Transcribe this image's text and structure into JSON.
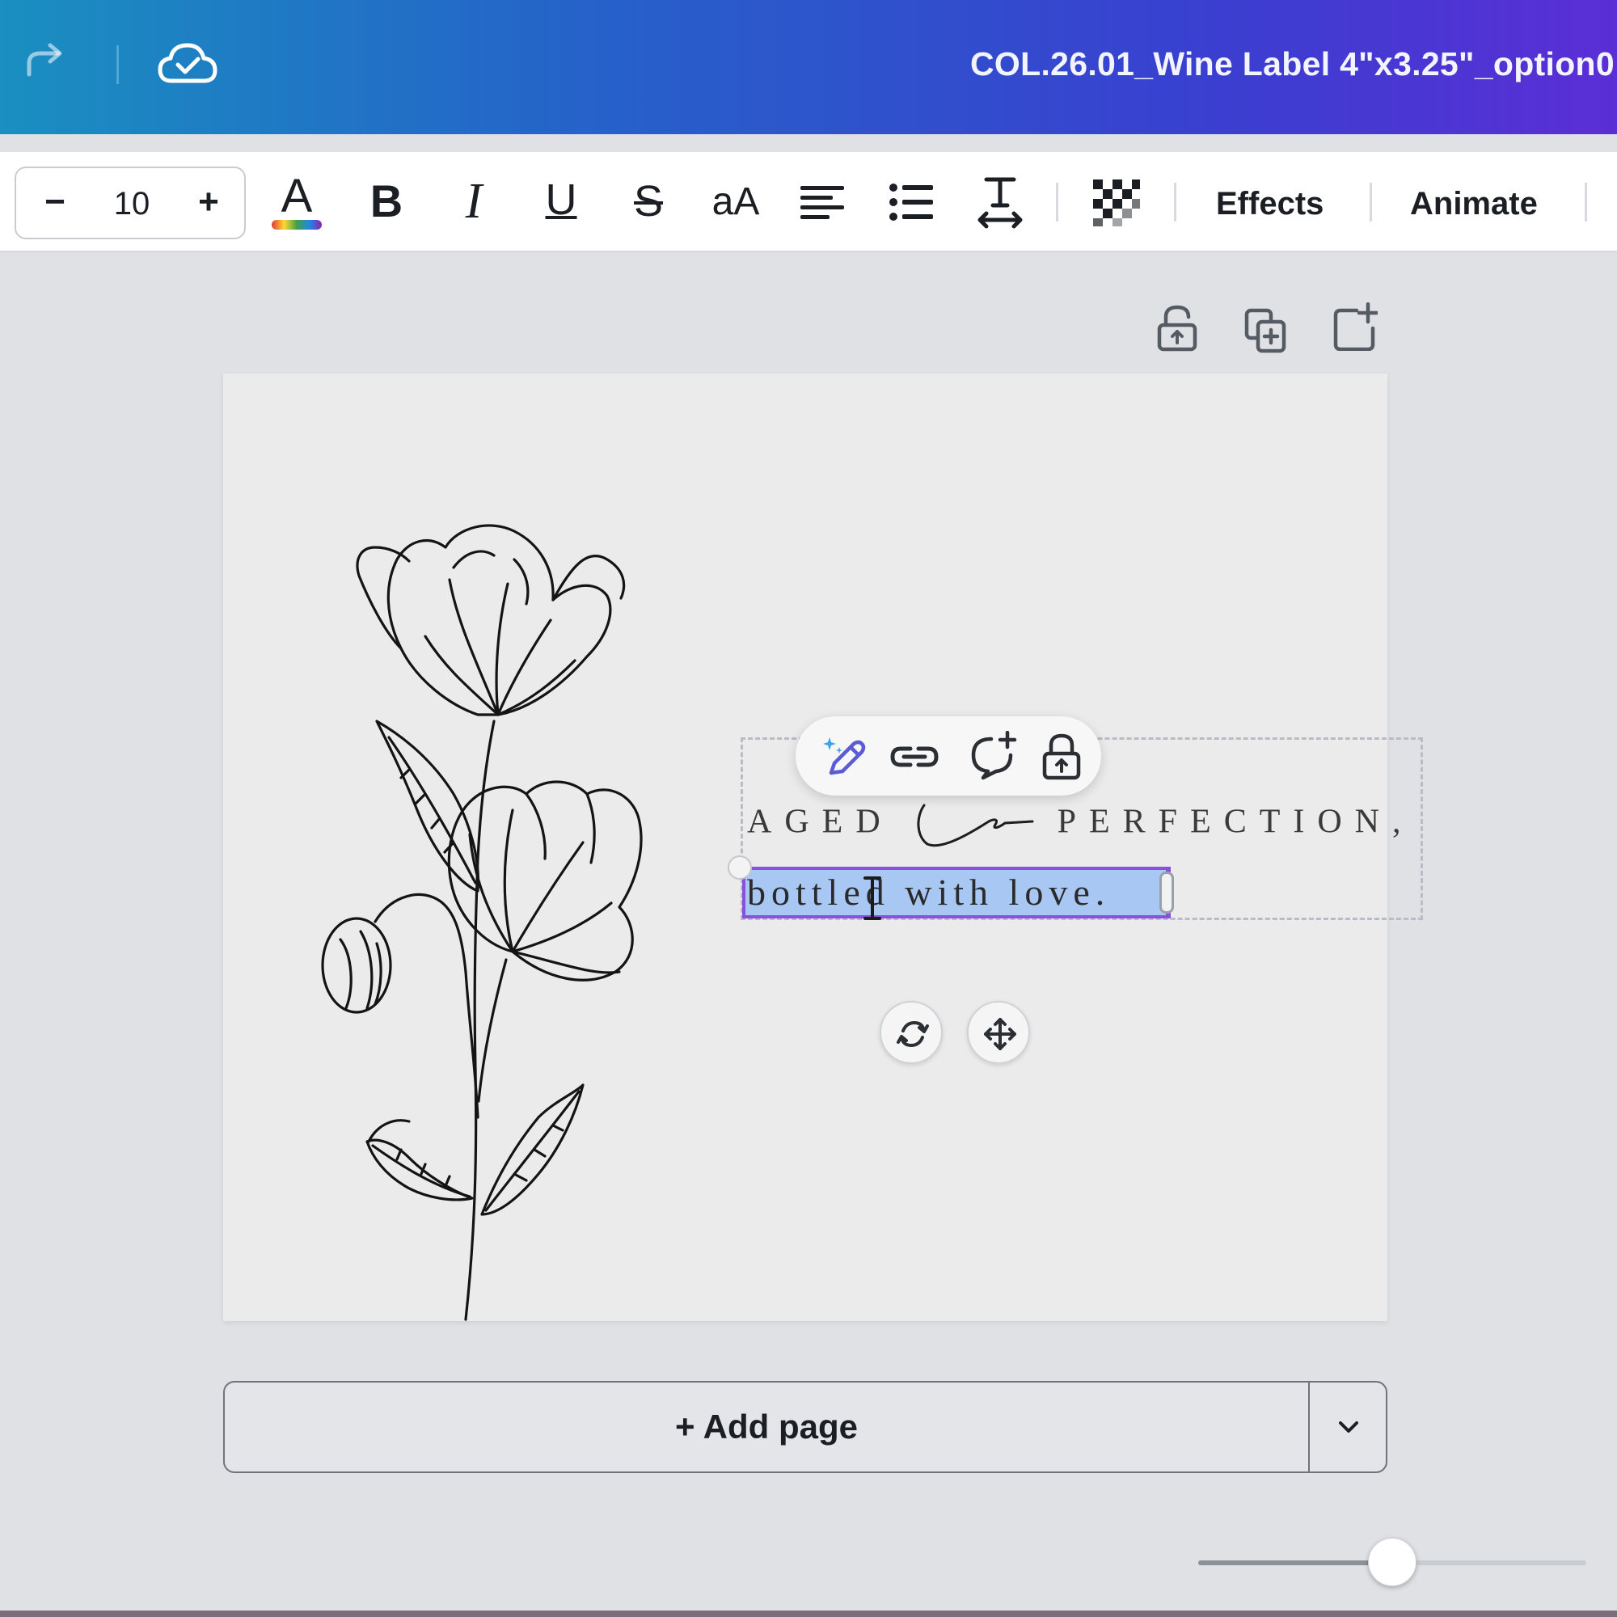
{
  "header": {
    "title": "COL.26.01_Wine Label 4\"x3.25\"_option0",
    "icons": [
      "redo-icon",
      "cloud-saved-icon"
    ]
  },
  "toolbar": {
    "font_size": "10",
    "decrease_label": "−",
    "increase_label": "+",
    "text_color_letter": "A",
    "bold_label": "B",
    "italic_label": "I",
    "underline_label": "U",
    "strikethrough_label": "S",
    "case_label": "aA",
    "effects_label": "Effects",
    "animate_label": "Animate"
  },
  "page_actions": [
    "lock-page-icon",
    "duplicate-page-icon",
    "add-page-icon"
  ],
  "design": {
    "line1_left": "AGED",
    "line1_right": "PERFECTION,",
    "selected_text": "bottled with love.",
    "context_toolbar": [
      "magic-edit-icon",
      "link-icon",
      "comment-add-icon",
      "lock-icon"
    ]
  },
  "add_page": {
    "label": "+ Add page"
  },
  "zoom": {
    "level_fraction": 0.5
  },
  "colors": {
    "header_gradient_start": "#1a8fc0",
    "header_gradient_end": "#5b2ed6",
    "selection_highlight": "#a9c7f3",
    "selection_border": "#8b4fe0"
  }
}
